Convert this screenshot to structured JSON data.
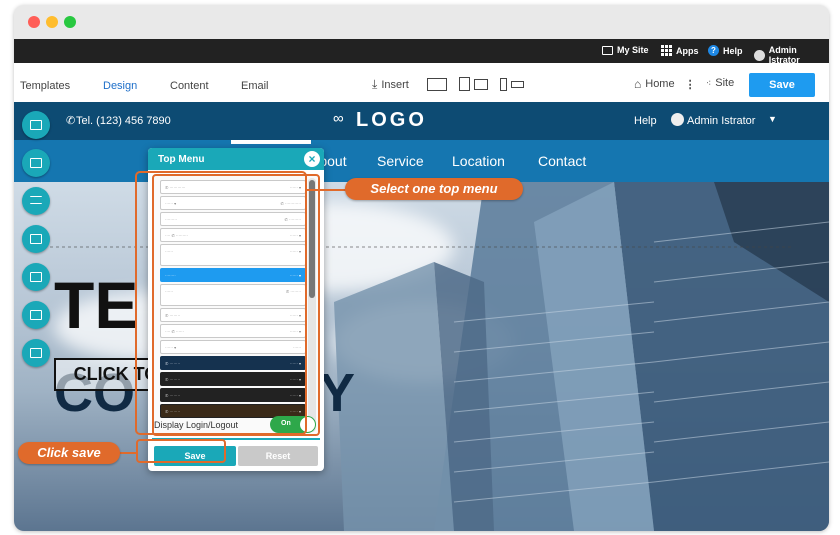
{
  "window": {
    "controls": [
      "close",
      "minimize",
      "maximize"
    ]
  },
  "admin_bar": {
    "my_site": "My Site",
    "apps": "Apps",
    "help": "Help",
    "user": "Admin Istrator"
  },
  "editor_toolbar": {
    "tabs": [
      "Templates",
      "Design",
      "Content",
      "Email"
    ],
    "active_tab": "Design",
    "insert": "Insert",
    "home": "Home",
    "site": "Site",
    "save": "Save"
  },
  "site_header": {
    "phone": "Tel. (123) 456 7890",
    "logo": "LOGO",
    "help": "Help",
    "user": "Admin Istrator",
    "nav": [
      "About",
      "Service",
      "Location",
      "Contact"
    ]
  },
  "hero": {
    "line1": "TE",
    "line2": "CO",
    "line2_tail": "Y",
    "cta": "CLICK TO"
  },
  "panel": {
    "title": "Top Menu",
    "display_login": "Display Login/Logout",
    "toggle": "On",
    "save": "Save",
    "reset": "Reset"
  },
  "callouts": {
    "select": "Select one top menu",
    "save": "Click save"
  },
  "colors": {
    "accent": "#1aa8b8",
    "callout": "#e06a2b",
    "nav_blue": "#1576b0",
    "header_navy": "#0d4b73",
    "save_blue": "#1e9bf0"
  }
}
